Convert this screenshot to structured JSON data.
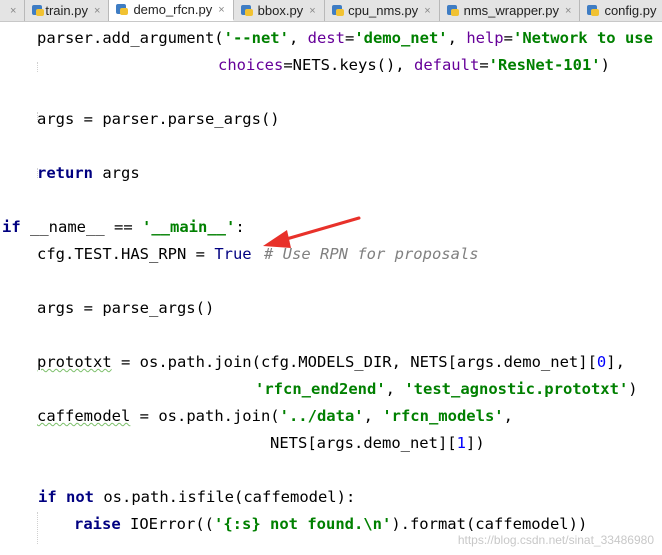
{
  "tabs": [
    {
      "label": "",
      "active": false
    },
    {
      "label": "train.py",
      "active": false
    },
    {
      "label": "demo_rfcn.py",
      "active": true
    },
    {
      "label": "bbox.py",
      "active": false
    },
    {
      "label": "cpu_nms.py",
      "active": false
    },
    {
      "label": "nms_wrapper.py",
      "active": false
    },
    {
      "label": "config.py",
      "active": false
    }
  ],
  "tab_close_glyph": "×",
  "code": {
    "l1": {
      "a": "parser.add_argument(",
      "s1": "'--net'",
      "b": ", ",
      "p1": "dest",
      "c": "=",
      "s2": "'demo_net'",
      "d": ", ",
      "p2": "help",
      "e": "=",
      "s3": "'Network to use [Re"
    },
    "l2": {
      "a": "choices",
      "b": "=NETS.keys(), ",
      "p": "default",
      "c": "=",
      "s": "'ResNet-101'",
      "d": ")"
    },
    "l3": {
      "a": "args = parser.parse_args()"
    },
    "l4": {
      "kw": "return",
      "a": " args"
    },
    "l5": {
      "kw": "if",
      "a": " __name__ == ",
      "s": "'__main__'",
      "b": ":"
    },
    "l6": {
      "a": "cfg.TEST.HAS_RPN = ",
      "kw": "True",
      "cmt": "# Use RPN for proposals"
    },
    "l7": {
      "a": "args = parse_args()"
    },
    "l8": {
      "a": "prototxt",
      "b": " = os.path.join(cfg.MODELS_DIR, NETS[args.demo_net][",
      "n": "0",
      "c": "],"
    },
    "l9": {
      "s1": "'rfcn_end2end'",
      "a": ", ",
      "s2": "'test_agnostic.prototxt'",
      "b": ")"
    },
    "l10": {
      "a": "caffemodel",
      "b": " = os.path.join(",
      "s1": "'../data'",
      "c": ", ",
      "s2": "'rfcn_models'",
      "d": ","
    },
    "l11": {
      "a": "NETS[args.demo_net][",
      "n": "1",
      "b": "])"
    },
    "l12": {
      "kw1": "if",
      "sp": " ",
      "kw2": "not",
      "a": " os.path.isfile(caffemodel):"
    },
    "l13": {
      "kw": "raise",
      "a": " IOError((",
      "s": "'{:s} not found.\\n'",
      "b": ").format(caffemodel))"
    }
  },
  "watermark": "https://blog.csdn.net/sinat_33486980",
  "colors": {
    "keyword": "#000080",
    "string": "#008000",
    "param": "#660099",
    "comment": "#808080",
    "number": "#0000ff",
    "arrow": "#e8312a"
  },
  "icons": {
    "tab_file": "python-file-icon",
    "annotation": "red-arrow-icon"
  }
}
